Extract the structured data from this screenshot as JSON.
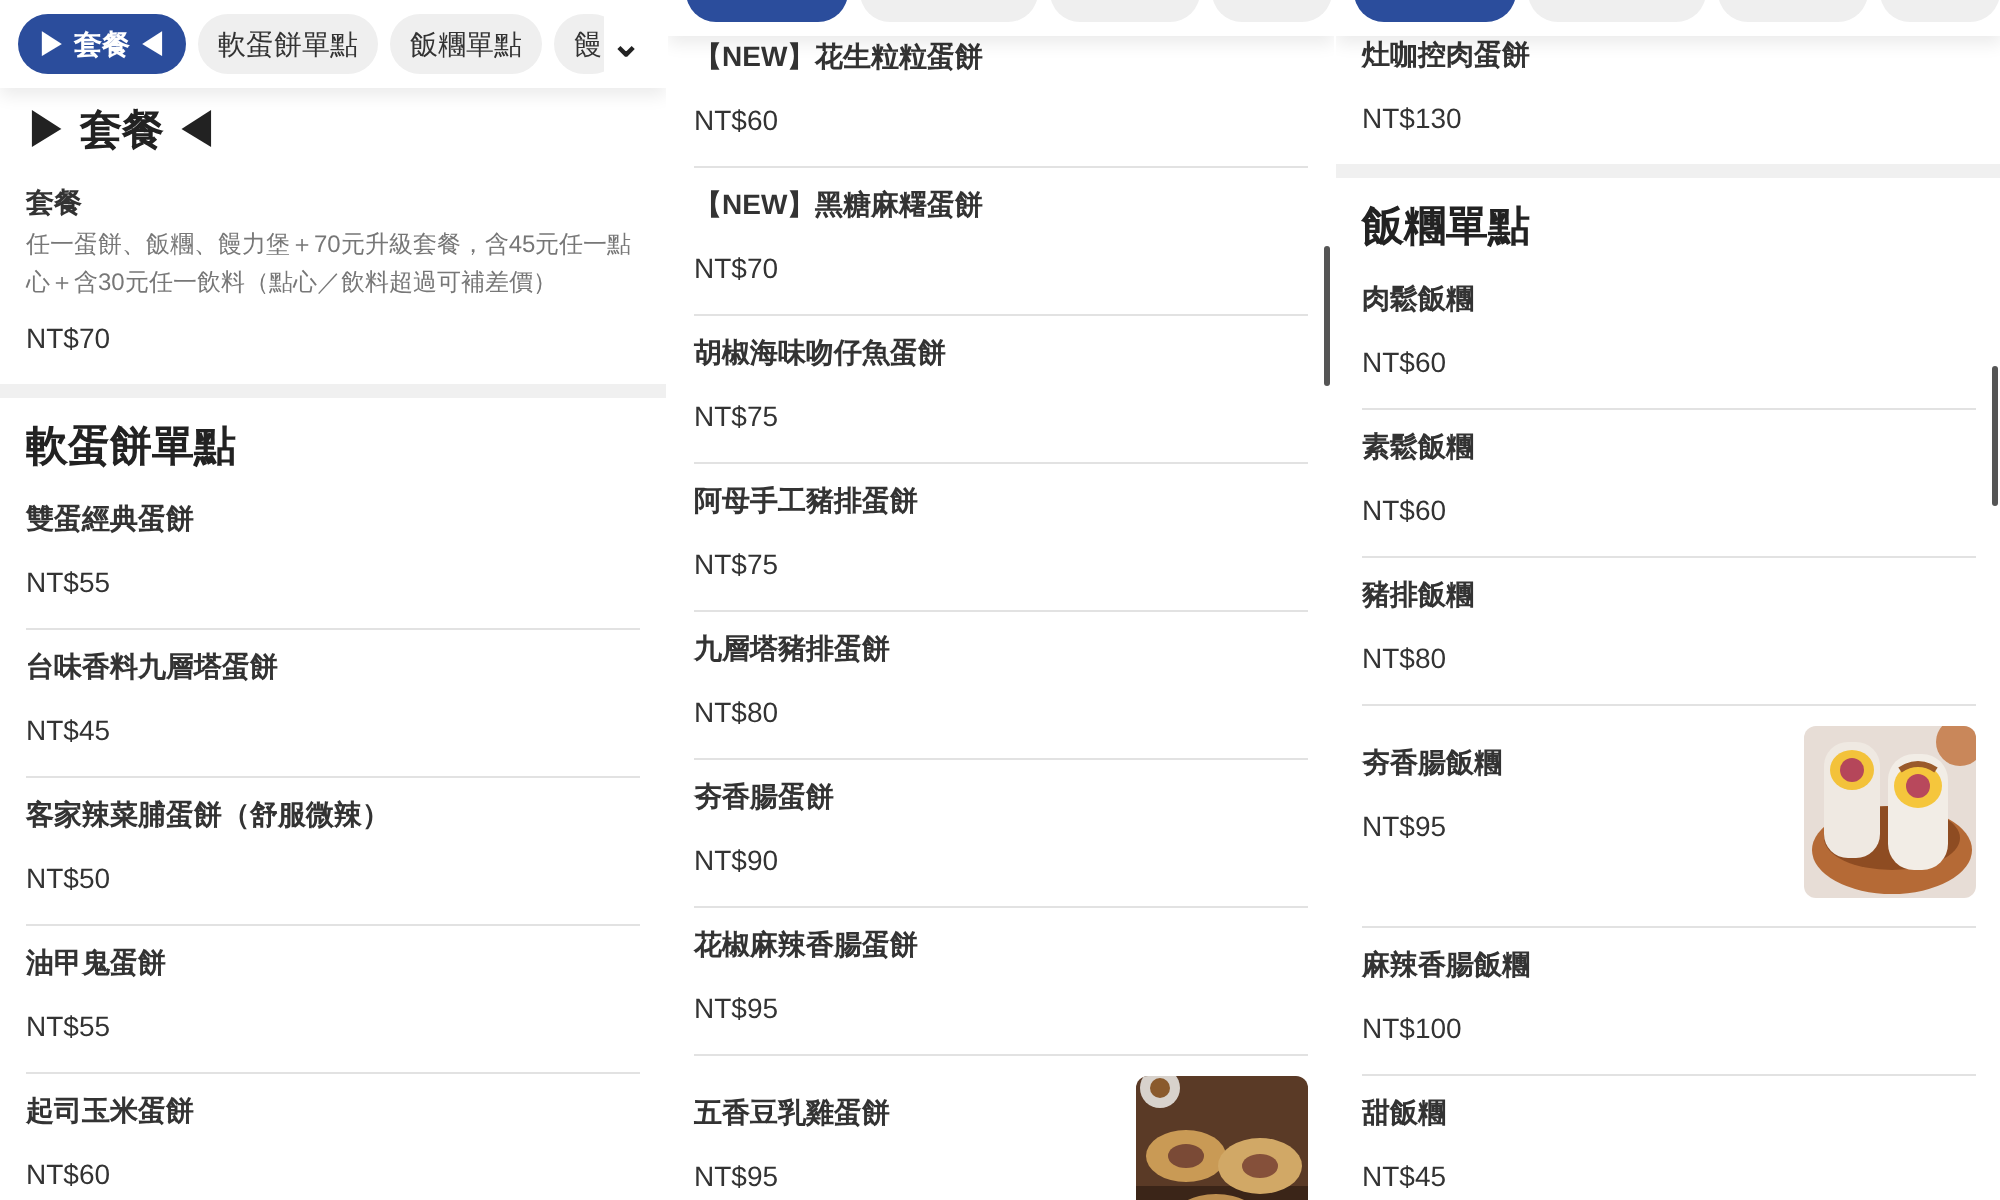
{
  "panels": [
    {
      "tabs": [
        {
          "label": "▶ 套餐 ◀",
          "selected": true
        },
        {
          "label": "軟蛋餅單點",
          "selected": false
        },
        {
          "label": "飯糰單點",
          "selected": false
        },
        {
          "label": "饅",
          "selected": false
        }
      ],
      "more_tabs_button": "⌄",
      "sections": [
        {
          "title": "▶ 套餐 ◀",
          "items": [
            {
              "name": "套餐",
              "description": "任一蛋餅、飯糰、饅力堡＋70元升級套餐，含45元任一點心＋含30元任一飲料（點心／飲料超過可補差價）",
              "price": "NT$70"
            }
          ]
        },
        {
          "title": "軟蛋餅單點",
          "items": [
            {
              "name": "雙蛋經典蛋餅",
              "price": "NT$55"
            },
            {
              "name": "台味香料九層塔蛋餅",
              "price": "NT$45"
            },
            {
              "name": "客家辣菜脯蛋餅（舒服微辣）",
              "price": "NT$50"
            },
            {
              "name": "油甲鬼蛋餅",
              "price": "NT$55"
            },
            {
              "name": "起司玉米蛋餅",
              "price": "NT$60"
            }
          ]
        }
      ]
    },
    {
      "tabs": [
        {
          "selected": true
        },
        {
          "selected": false
        },
        {
          "selected": false
        },
        {
          "selected": false
        }
      ],
      "scrollbar": true,
      "sections": [
        {
          "items": [
            {
              "name": "【NEW】花生粒粒蛋餅",
              "price": "NT$60"
            },
            {
              "name": "【NEW】黑糖麻糬蛋餅",
              "price": "NT$70"
            },
            {
              "name": "胡椒海味吻仔魚蛋餅",
              "price": "NT$75"
            },
            {
              "name": "阿母手工豬排蛋餅",
              "price": "NT$75"
            },
            {
              "name": "九層塔豬排蛋餅",
              "price": "NT$80"
            },
            {
              "name": "夯香腸蛋餅",
              "price": "NT$90"
            },
            {
              "name": "花椒麻辣香腸蛋餅",
              "price": "NT$95"
            },
            {
              "name": "五香豆乳雞蛋餅",
              "price": "NT$95"
            }
          ]
        }
      ]
    },
    {
      "tabs": [
        {
          "selected": true
        },
        {
          "selected": false
        },
        {
          "selected": false
        },
        {
          "selected": false
        }
      ],
      "scrollbar": true,
      "sections": [
        {
          "items": [
            {
              "name": "灶咖控肉蛋餅",
              "price": "NT$130"
            }
          ]
        },
        {
          "title": "飯糰單點",
          "items": [
            {
              "name": "肉鬆飯糰",
              "price": "NT$60"
            },
            {
              "name": "素鬆飯糰",
              "price": "NT$60"
            },
            {
              "name": "豬排飯糰",
              "price": "NT$80"
            },
            {
              "name": "夯香腸飯糰",
              "price": "NT$95"
            },
            {
              "name": "麻辣香腸飯糰",
              "price": "NT$100"
            },
            {
              "name": "甜飯糰",
              "price": "NT$45"
            }
          ]
        }
      ]
    }
  ]
}
